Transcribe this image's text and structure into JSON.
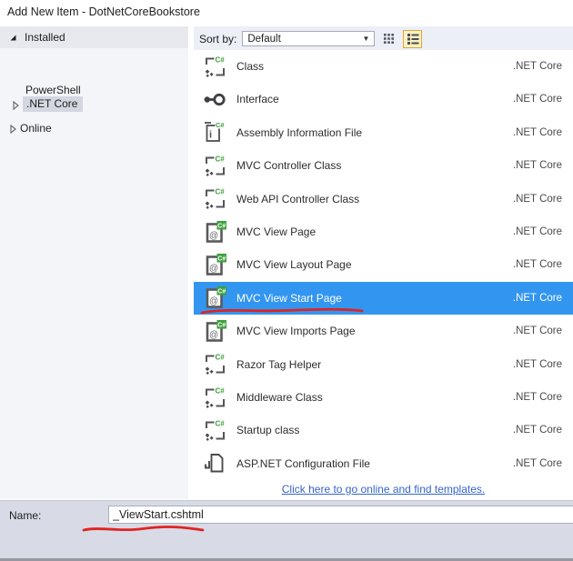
{
  "window": {
    "title": "Add New Item - DotNetCoreBookstore"
  },
  "sidebar": {
    "header": "Installed",
    "items": [
      {
        "label": "PowerShell",
        "arrow": "none",
        "selected": false
      },
      {
        "label": ".NET Core",
        "arrow": "collapsed",
        "selected": true
      },
      {
        "label": "Online",
        "arrow": "collapsed",
        "selected": false
      }
    ]
  },
  "sort_bar": {
    "label": "Sort by:",
    "dropdown_value": "Default",
    "view_buttons": [
      {
        "name": "small-icons-view",
        "active": false
      },
      {
        "name": "list-view",
        "active": true
      }
    ]
  },
  "list": {
    "items": [
      {
        "name": "Class",
        "platform": ".NET Core",
        "icon": "class",
        "selected": false
      },
      {
        "name": "Interface",
        "platform": ".NET Core",
        "icon": "interface",
        "selected": false
      },
      {
        "name": "Assembly Information File",
        "platform": ".NET Core",
        "icon": "assembly-info",
        "selected": false
      },
      {
        "name": "MVC Controller Class",
        "platform": ".NET Core",
        "icon": "class",
        "selected": false
      },
      {
        "name": "Web API Controller Class",
        "platform": ".NET Core",
        "icon": "class",
        "selected": false
      },
      {
        "name": "MVC View Page",
        "platform": ".NET Core",
        "icon": "view-page",
        "selected": false
      },
      {
        "name": "MVC View Layout Page",
        "platform": ".NET Core",
        "icon": "view-page",
        "selected": false
      },
      {
        "name": "MVC View Start Page",
        "platform": ".NET Core",
        "icon": "view-page",
        "selected": true
      },
      {
        "name": "MVC View Imports Page",
        "platform": ".NET Core",
        "icon": "view-page",
        "selected": false
      },
      {
        "name": "Razor Tag Helper",
        "platform": ".NET Core",
        "icon": "class",
        "selected": false
      },
      {
        "name": "Middleware Class",
        "platform": ".NET Core",
        "icon": "class",
        "selected": false
      },
      {
        "name": "Startup class",
        "platform": ".NET Core",
        "icon": "class",
        "selected": false
      },
      {
        "name": "ASP.NET Configuration File",
        "platform": ".NET Core",
        "icon": "config-file",
        "selected": false
      }
    ],
    "link": "Click here to go online and find templates."
  },
  "footer": {
    "name_label": "Name:",
    "name_value": "_ViewStart.cshtml"
  },
  "colors": {
    "selection_blue": "#3296f1",
    "annotation_red": "#e02320",
    "csharp_green": "#3da03c",
    "link_blue": "#3565c8",
    "footer_bg": "#d8dbe6",
    "sidebar_selection": "#d5d7e0",
    "active_button_bg": "#fbf2c3",
    "active_button_border": "#dfa73c"
  }
}
